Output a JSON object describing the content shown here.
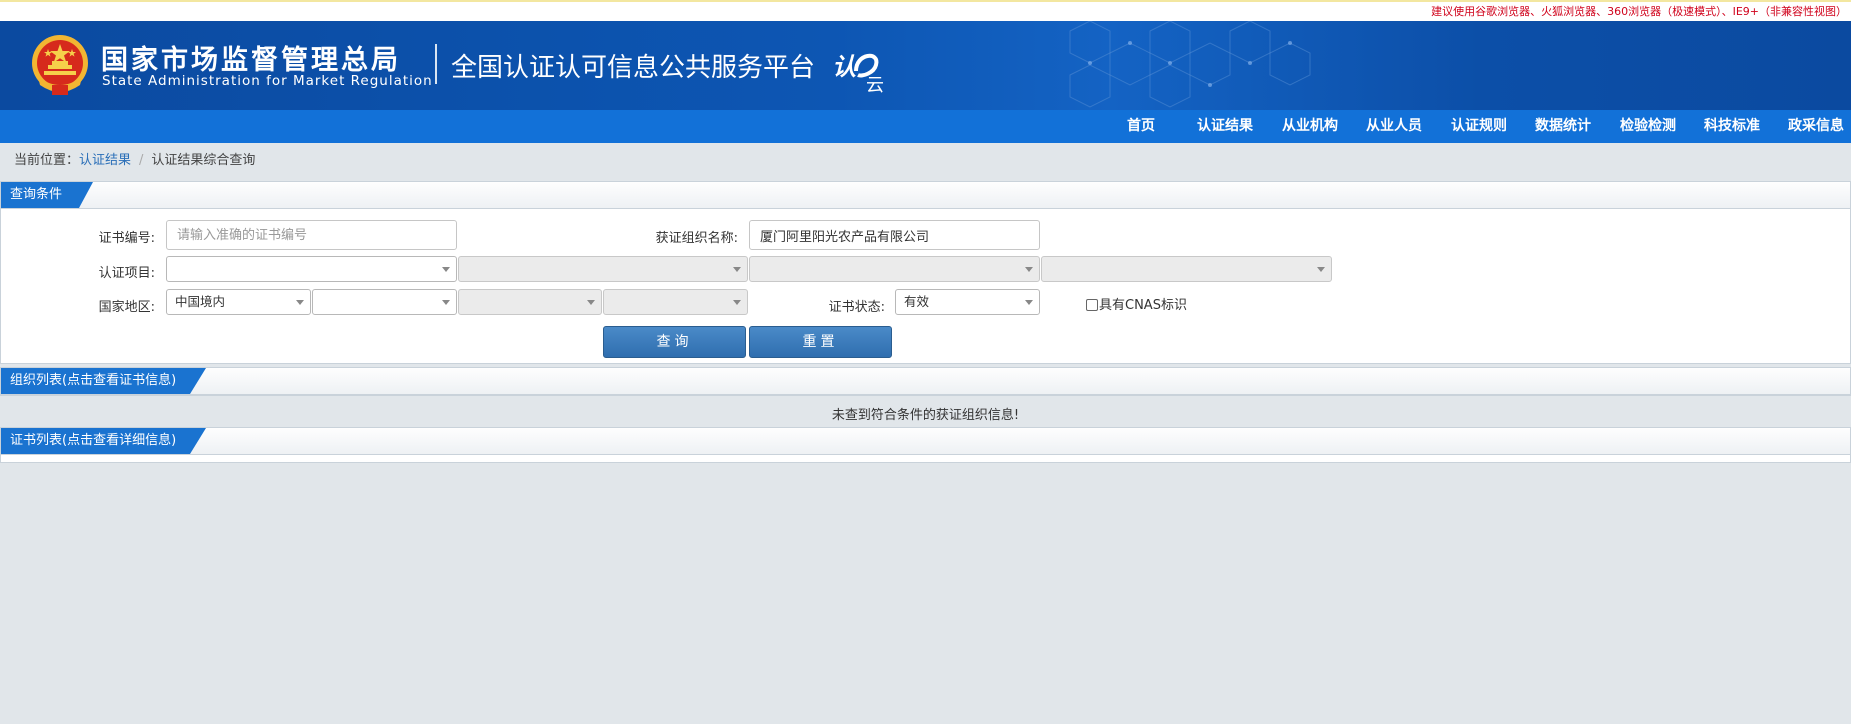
{
  "notice": "建议使用谷歌浏览器、火狐浏览器、360浏览器（极速模式）、IE9+（非兼容性视图）",
  "header": {
    "org_name_cn": "国家市场监督管理总局",
    "org_name_en": "State Administration  for  Market Regulation",
    "platform_title": "全国认证认可信息公共服务平台",
    "brand_mark_text": "认云"
  },
  "nav": {
    "items": [
      {
        "label": "首页"
      },
      {
        "label": "认证结果"
      },
      {
        "label": "从业机构"
      },
      {
        "label": "从业人员"
      },
      {
        "label": "认证规则"
      },
      {
        "label": "数据统计"
      },
      {
        "label": "检验检测"
      },
      {
        "label": "科技标准"
      },
      {
        "label": "政采信息"
      }
    ]
  },
  "breadcrumb": {
    "prefix": "当前位置：",
    "link": "认证结果",
    "separator": "/",
    "current": "认证结果综合查询"
  },
  "query": {
    "panel_title": "查询条件",
    "cert_no_label": "证书编号:",
    "cert_no_value": "",
    "cert_no_placeholder": "请输入准确的证书编号",
    "org_name_label": "获证组织名称:",
    "org_name_value": "厦门阿里阳光农产品有限公司",
    "cert_project_label": "认证项目:",
    "cert_project_selects": [
      "",
      "",
      "",
      ""
    ],
    "region_label": "国家地区:",
    "region_selects": [
      "中国境内",
      "",
      "",
      ""
    ],
    "cert_status_label": "证书状态:",
    "cert_status_value": "有效",
    "cnas_label": "具有CNAS标识",
    "cnas_checked": false,
    "search_button": "查询",
    "reset_button": "重置"
  },
  "org_list": {
    "panel_title": "组织列表(点击查看证书信息)",
    "empty_message": "未查到符合条件的获证组织信息!"
  },
  "cert_list": {
    "panel_title": "证书列表(点击查看详细信息)"
  },
  "colors": {
    "header_blue": "#0b4aa0",
    "nav_blue": "#1271d8",
    "tab_blue": "#1a73d0",
    "button_blue": "#3a7bbf",
    "notice_red": "#d0021b",
    "page_bg": "#e1e6ea"
  }
}
